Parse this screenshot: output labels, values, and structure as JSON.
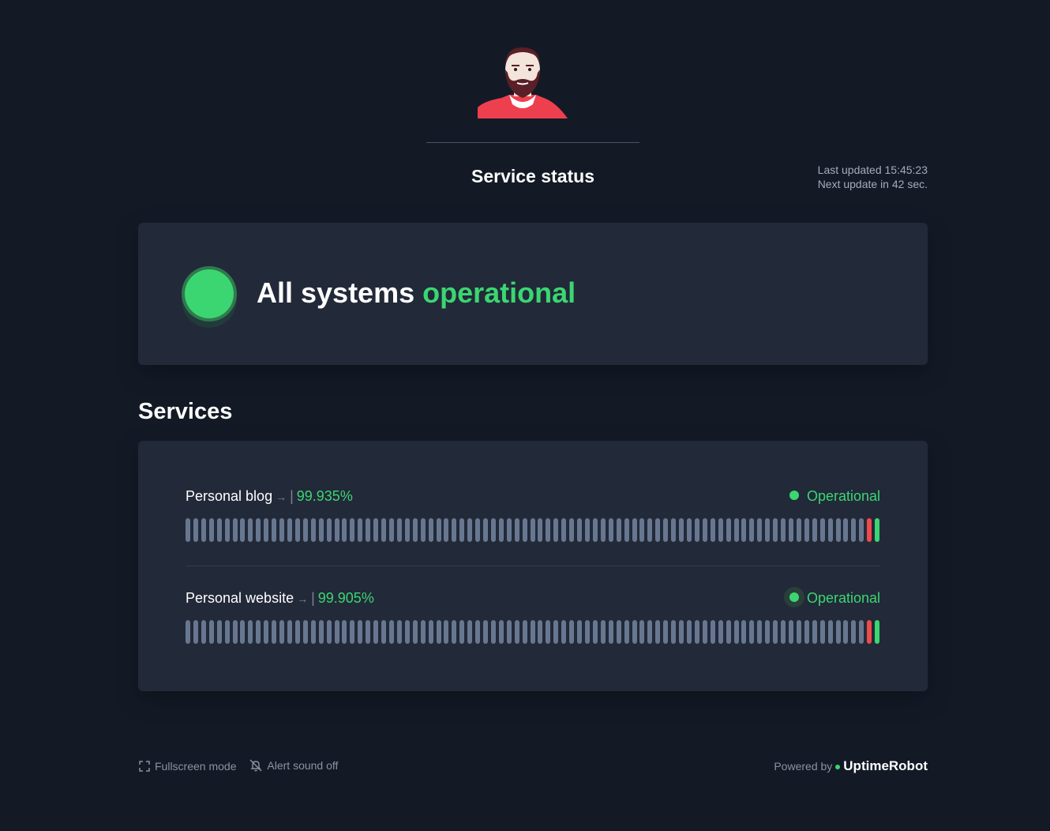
{
  "header": {
    "title": "Service status",
    "last_updated": "Last updated 15:45:23",
    "next_update": "Next update in 42 sec."
  },
  "overall": {
    "text": "All systems",
    "status": "operational",
    "color": "#3bd671"
  },
  "services": {
    "title": "Services",
    "items": [
      {
        "name": "Personal blog",
        "uptime": "99.935%",
        "status": "Operational",
        "bars": [
          "up",
          "up",
          "up",
          "up",
          "up",
          "up",
          "up",
          "up",
          "up",
          "up",
          "up",
          "up",
          "up",
          "up",
          "up",
          "up",
          "up",
          "up",
          "up",
          "up",
          "up",
          "up",
          "up",
          "up",
          "up",
          "up",
          "up",
          "up",
          "up",
          "up",
          "up",
          "up",
          "up",
          "up",
          "up",
          "up",
          "up",
          "up",
          "up",
          "up",
          "up",
          "up",
          "up",
          "up",
          "up",
          "up",
          "up",
          "up",
          "up",
          "up",
          "up",
          "up",
          "up",
          "up",
          "up",
          "up",
          "up",
          "up",
          "up",
          "up",
          "up",
          "up",
          "up",
          "up",
          "up",
          "up",
          "up",
          "up",
          "up",
          "up",
          "up",
          "up",
          "up",
          "up",
          "up",
          "up",
          "up",
          "up",
          "up",
          "up",
          "up",
          "up",
          "up",
          "up",
          "up",
          "up",
          "up",
          "down",
          "up"
        ]
      },
      {
        "name": "Personal website",
        "uptime": "99.905%",
        "status": "Operational",
        "bars": [
          "up",
          "up",
          "up",
          "up",
          "up",
          "up",
          "up",
          "up",
          "up",
          "up",
          "up",
          "up",
          "up",
          "up",
          "up",
          "up",
          "up",
          "up",
          "up",
          "up",
          "up",
          "up",
          "up",
          "up",
          "up",
          "up",
          "up",
          "up",
          "up",
          "up",
          "up",
          "up",
          "up",
          "up",
          "up",
          "up",
          "up",
          "up",
          "up",
          "up",
          "up",
          "up",
          "up",
          "up",
          "up",
          "up",
          "up",
          "up",
          "up",
          "up",
          "up",
          "up",
          "up",
          "up",
          "up",
          "up",
          "up",
          "up",
          "up",
          "up",
          "up",
          "up",
          "up",
          "up",
          "up",
          "up",
          "up",
          "up",
          "up",
          "up",
          "up",
          "up",
          "up",
          "up",
          "up",
          "up",
          "up",
          "up",
          "up",
          "up",
          "up",
          "up",
          "up",
          "up",
          "up",
          "up",
          "up",
          "down",
          "up"
        ]
      }
    ]
  },
  "footer": {
    "fullscreen_label": "Fullscreen mode",
    "alert_label": "Alert sound off",
    "powered_by": "Powered by",
    "brand": "UptimeRobot"
  },
  "icons": {
    "fullscreen": "fullscreen-icon",
    "bell_off": "bell-off-icon",
    "arrow": "arrow-right-icon"
  },
  "colors": {
    "background": "#131a26",
    "card": "#222939",
    "operational": "#3bd671",
    "down": "#ee4a4a",
    "no_data": "#687790"
  }
}
